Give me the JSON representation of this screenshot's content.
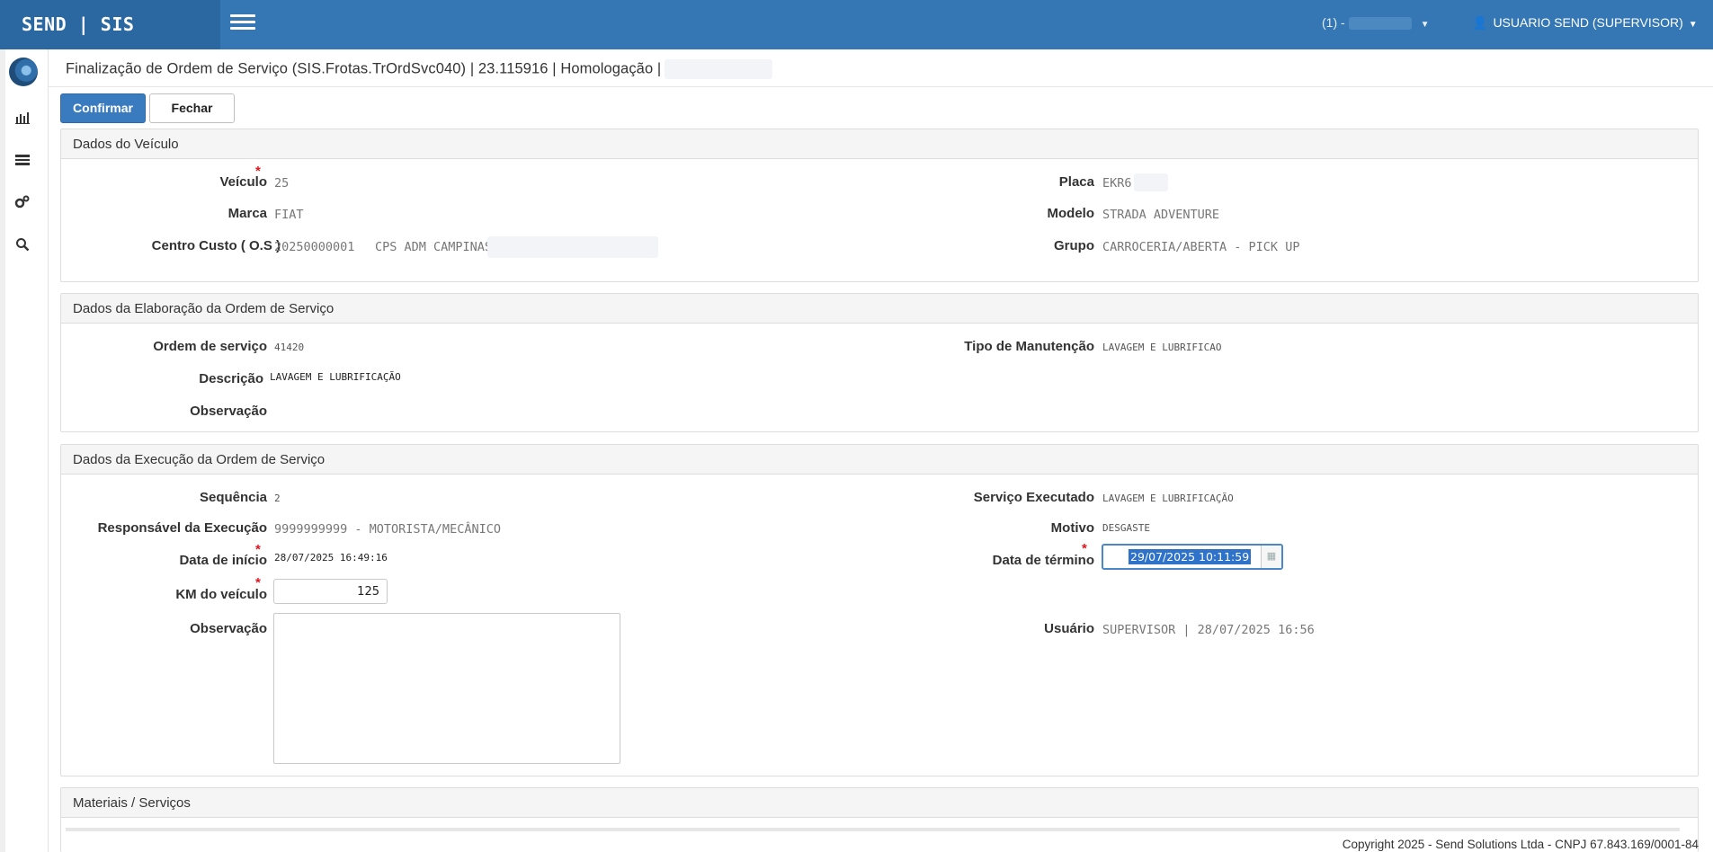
{
  "topbar": {
    "brand": "SEND | SIS",
    "selector_label": "(1) -",
    "user_label": "USUARIO SEND (SUPERVISOR)"
  },
  "sidebar": {
    "items": [
      "logo-icon",
      "chart-icon",
      "list-icon",
      "settings-icon",
      "search-icon"
    ]
  },
  "page": {
    "title": "Finalização de Ordem de Serviço (SIS.Frotas.TrOrdSvc040) | 23.115916 | Homologação |"
  },
  "actions": {
    "confirm_label": "Confirmar",
    "close_label": "Fechar"
  },
  "veiculo": {
    "header": "Dados do Veículo",
    "veiculo_label": "Veículo",
    "veiculo_value": "25",
    "marca_label": "Marca",
    "marca_value": "FIAT",
    "centro_label": "Centro Custo ( O.S )",
    "centro_code": "20250000001",
    "centro_name": "CPS ADM CAMPINAS",
    "placa_label": "Placa",
    "placa_value": "EKR6",
    "modelo_label": "Modelo",
    "modelo_value": "STRADA ADVENTURE",
    "grupo_label": "Grupo",
    "grupo_value": "CARROCERIA/ABERTA - PICK UP"
  },
  "elaboracao": {
    "header": "Dados da Elaboração da Ordem de Serviço",
    "ordem_label": "Ordem de serviço",
    "ordem_value": "41420",
    "descricao_label": "Descrição",
    "descricao_value": "LAVAGEM E LUBRIFICAÇÃO",
    "observacao_label": "Observação",
    "tipo_label": "Tipo de Manutenção",
    "tipo_value": "LAVAGEM E LUBRIFICAO"
  },
  "execucao": {
    "header": "Dados da Execução da Ordem de Serviço",
    "sequencia_label": "Sequência",
    "sequencia_value": "2",
    "responsavel_label": "Responsável da Execução",
    "responsavel_value": "9999999999 - MOTORISTA/MECÂNICO",
    "inicio_label": "Data de início",
    "inicio_value": "28/07/2025 16:49:16",
    "km_label": "KM do veículo",
    "km_value": "125",
    "observacao_label": "Observação",
    "servico_label": "Serviço Executado",
    "servico_value": "LAVAGEM E LUBRIFICAÇÃO",
    "motivo_label": "Motivo",
    "motivo_value": "DESGASTE",
    "termino_label": "Data de término",
    "termino_value": "29/07/2025 10:11:59",
    "usuario_label": "Usuário",
    "usuario_value": "SUPERVISOR | 28/07/2025 16:56"
  },
  "materiais": {
    "header": "Materiais / Serviços"
  },
  "footer": {
    "text": "Copyright 2025 - Send Solutions Ltda - CNPJ 67.843.169/0001-84"
  }
}
